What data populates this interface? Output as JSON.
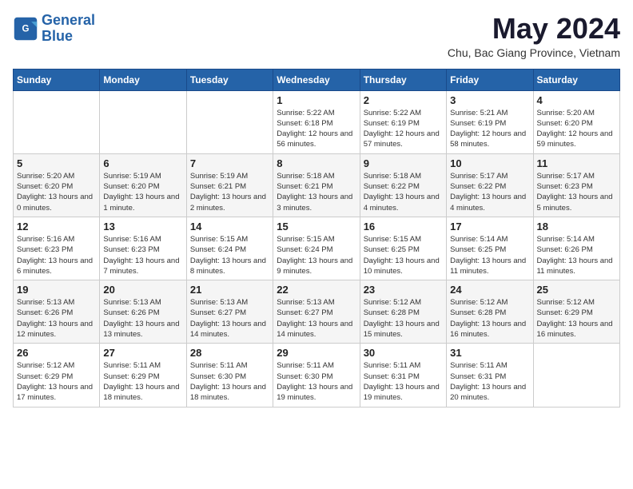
{
  "header": {
    "logo_line1": "General",
    "logo_line2": "Blue",
    "title": "May 2024",
    "subtitle": "Chu, Bac Giang Province, Vietnam"
  },
  "weekdays": [
    "Sunday",
    "Monday",
    "Tuesday",
    "Wednesday",
    "Thursday",
    "Friday",
    "Saturday"
  ],
  "weeks": [
    [
      {
        "day": "",
        "info": ""
      },
      {
        "day": "",
        "info": ""
      },
      {
        "day": "",
        "info": ""
      },
      {
        "day": "1",
        "info": "Sunrise: 5:22 AM\nSunset: 6:18 PM\nDaylight: 12 hours\nand 56 minutes."
      },
      {
        "day": "2",
        "info": "Sunrise: 5:22 AM\nSunset: 6:19 PM\nDaylight: 12 hours\nand 57 minutes."
      },
      {
        "day": "3",
        "info": "Sunrise: 5:21 AM\nSunset: 6:19 PM\nDaylight: 12 hours\nand 58 minutes."
      },
      {
        "day": "4",
        "info": "Sunrise: 5:20 AM\nSunset: 6:20 PM\nDaylight: 12 hours\nand 59 minutes."
      }
    ],
    [
      {
        "day": "5",
        "info": "Sunrise: 5:20 AM\nSunset: 6:20 PM\nDaylight: 13 hours\nand 0 minutes."
      },
      {
        "day": "6",
        "info": "Sunrise: 5:19 AM\nSunset: 6:20 PM\nDaylight: 13 hours\nand 1 minute."
      },
      {
        "day": "7",
        "info": "Sunrise: 5:19 AM\nSunset: 6:21 PM\nDaylight: 13 hours\nand 2 minutes."
      },
      {
        "day": "8",
        "info": "Sunrise: 5:18 AM\nSunset: 6:21 PM\nDaylight: 13 hours\nand 3 minutes."
      },
      {
        "day": "9",
        "info": "Sunrise: 5:18 AM\nSunset: 6:22 PM\nDaylight: 13 hours\nand 4 minutes."
      },
      {
        "day": "10",
        "info": "Sunrise: 5:17 AM\nSunset: 6:22 PM\nDaylight: 13 hours\nand 4 minutes."
      },
      {
        "day": "11",
        "info": "Sunrise: 5:17 AM\nSunset: 6:23 PM\nDaylight: 13 hours\nand 5 minutes."
      }
    ],
    [
      {
        "day": "12",
        "info": "Sunrise: 5:16 AM\nSunset: 6:23 PM\nDaylight: 13 hours\nand 6 minutes."
      },
      {
        "day": "13",
        "info": "Sunrise: 5:16 AM\nSunset: 6:23 PM\nDaylight: 13 hours\nand 7 minutes."
      },
      {
        "day": "14",
        "info": "Sunrise: 5:15 AM\nSunset: 6:24 PM\nDaylight: 13 hours\nand 8 minutes."
      },
      {
        "day": "15",
        "info": "Sunrise: 5:15 AM\nSunset: 6:24 PM\nDaylight: 13 hours\nand 9 minutes."
      },
      {
        "day": "16",
        "info": "Sunrise: 5:15 AM\nSunset: 6:25 PM\nDaylight: 13 hours\nand 10 minutes."
      },
      {
        "day": "17",
        "info": "Sunrise: 5:14 AM\nSunset: 6:25 PM\nDaylight: 13 hours\nand 11 minutes."
      },
      {
        "day": "18",
        "info": "Sunrise: 5:14 AM\nSunset: 6:26 PM\nDaylight: 13 hours\nand 11 minutes."
      }
    ],
    [
      {
        "day": "19",
        "info": "Sunrise: 5:13 AM\nSunset: 6:26 PM\nDaylight: 13 hours\nand 12 minutes."
      },
      {
        "day": "20",
        "info": "Sunrise: 5:13 AM\nSunset: 6:26 PM\nDaylight: 13 hours\nand 13 minutes."
      },
      {
        "day": "21",
        "info": "Sunrise: 5:13 AM\nSunset: 6:27 PM\nDaylight: 13 hours\nand 14 minutes."
      },
      {
        "day": "22",
        "info": "Sunrise: 5:13 AM\nSunset: 6:27 PM\nDaylight: 13 hours\nand 14 minutes."
      },
      {
        "day": "23",
        "info": "Sunrise: 5:12 AM\nSunset: 6:28 PM\nDaylight: 13 hours\nand 15 minutes."
      },
      {
        "day": "24",
        "info": "Sunrise: 5:12 AM\nSunset: 6:28 PM\nDaylight: 13 hours\nand 16 minutes."
      },
      {
        "day": "25",
        "info": "Sunrise: 5:12 AM\nSunset: 6:29 PM\nDaylight: 13 hours\nand 16 minutes."
      }
    ],
    [
      {
        "day": "26",
        "info": "Sunrise: 5:12 AM\nSunset: 6:29 PM\nDaylight: 13 hours\nand 17 minutes."
      },
      {
        "day": "27",
        "info": "Sunrise: 5:11 AM\nSunset: 6:29 PM\nDaylight: 13 hours\nand 18 minutes."
      },
      {
        "day": "28",
        "info": "Sunrise: 5:11 AM\nSunset: 6:30 PM\nDaylight: 13 hours\nand 18 minutes."
      },
      {
        "day": "29",
        "info": "Sunrise: 5:11 AM\nSunset: 6:30 PM\nDaylight: 13 hours\nand 19 minutes."
      },
      {
        "day": "30",
        "info": "Sunrise: 5:11 AM\nSunset: 6:31 PM\nDaylight: 13 hours\nand 19 minutes."
      },
      {
        "day": "31",
        "info": "Sunrise: 5:11 AM\nSunset: 6:31 PM\nDaylight: 13 hours\nand 20 minutes."
      },
      {
        "day": "",
        "info": ""
      }
    ]
  ]
}
